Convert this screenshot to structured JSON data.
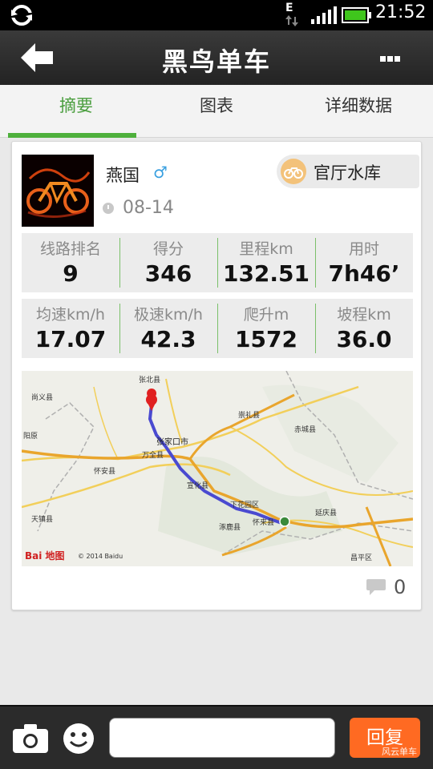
{
  "status_bar": {
    "time": "21:52",
    "data_indicator": "E"
  },
  "header": {
    "title": "黑鸟单车"
  },
  "tabs": [
    {
      "label": "摘要",
      "active": true
    },
    {
      "label": "图表",
      "active": false
    },
    {
      "label": "详细数据",
      "active": false
    }
  ],
  "ride": {
    "user": {
      "name": "燕国",
      "gender_symbol": "♂"
    },
    "date": "08-14",
    "route_name": "官厅水库",
    "stats_row1": [
      {
        "label": "线路排名",
        "value": "9"
      },
      {
        "label": "得分",
        "value": "346"
      },
      {
        "label": "里程km",
        "value": "132.51"
      },
      {
        "label": "用时",
        "value": "7h46’"
      }
    ],
    "stats_row2": [
      {
        "label": "均速km/h",
        "value": "17.07"
      },
      {
        "label": "极速km/h",
        "value": "42.3"
      },
      {
        "label": "爬升m",
        "value": "1572"
      },
      {
        "label": "坡程km",
        "value": "36.0"
      }
    ],
    "map": {
      "place_labels": [
        "张北县",
        "尚义县",
        "崇礼县",
        "赤城县",
        "张家口市",
        "万全县",
        "阳原",
        "怀安县",
        "宣化县",
        "下花园区",
        "天镇县",
        "涿鹿县",
        "怀来县",
        "延庆县",
        "昌平区"
      ],
      "logo": "Bai 地图",
      "copyright": "© 2014 Baidu"
    },
    "comment_count": "0"
  },
  "bottom_bar": {
    "input_value": "",
    "reply_label": "回复",
    "watermark": "风云单车"
  },
  "colors": {
    "accent_green": "#4eb03c",
    "reply_orange": "#ff6a22",
    "route_line": "#4a4ad0"
  }
}
